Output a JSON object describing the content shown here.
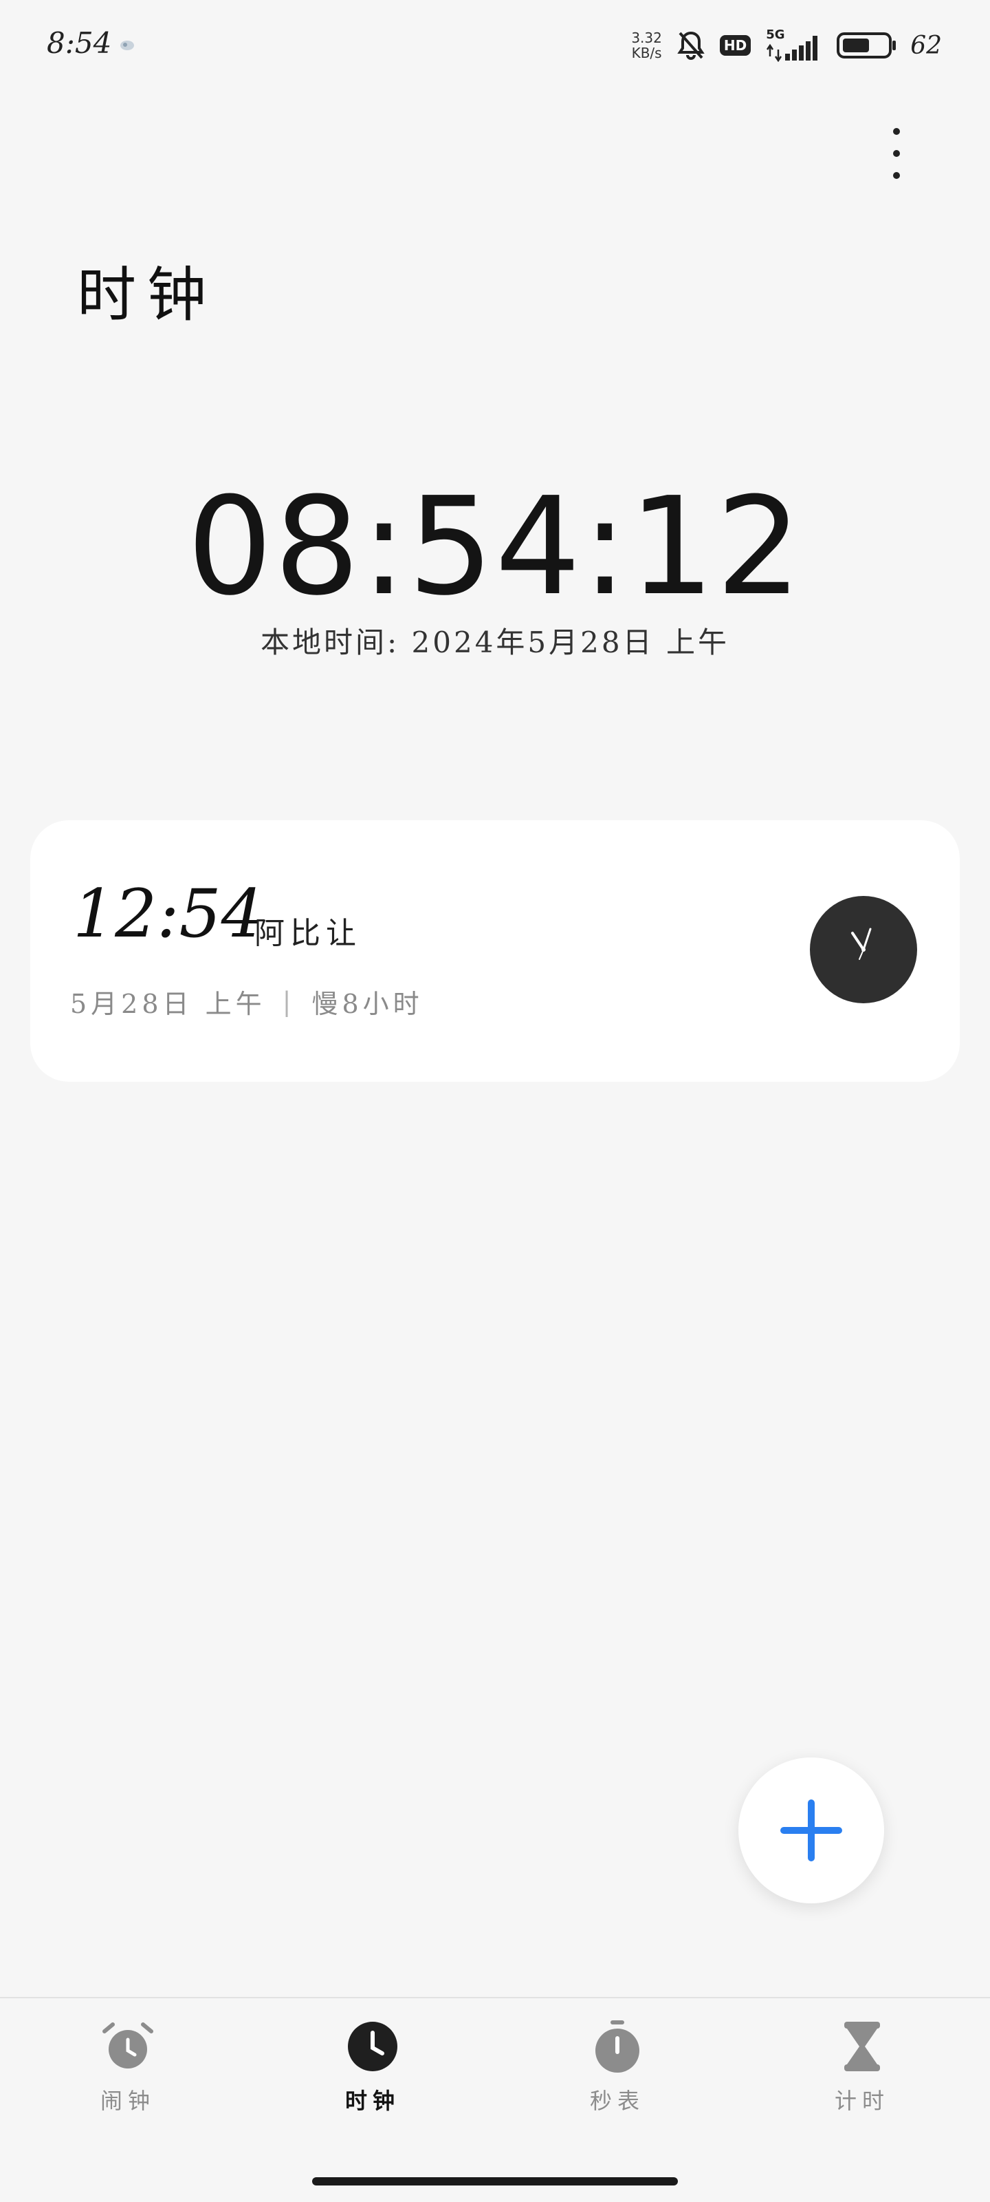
{
  "status_bar": {
    "time": "8:54",
    "net_speed_value": "3.32",
    "net_speed_unit": "KB/s",
    "hd_label": "HD",
    "network_label": "5G",
    "battery_percent": "62",
    "battery_level": 0.62,
    "icons": [
      "app-notification-icon",
      "bell-muted-icon",
      "hd-icon",
      "signal-5g-icon",
      "battery-icon"
    ]
  },
  "header": {
    "title": "时钟",
    "more_icon": "more-vertical-icon"
  },
  "main_clock": {
    "time": "08:54:12",
    "date_line": "本地时间: 2024年5月28日 上午"
  },
  "world_clocks": [
    {
      "time": "12:54",
      "city": "阿比让",
      "date": "5月28日 上午",
      "separator": "|",
      "offset": "慢8小时",
      "analog_icon": "analog-clock-icon"
    }
  ],
  "fab": {
    "icon": "plus-icon",
    "color": "#2a7ff0"
  },
  "bottom_nav": {
    "items": [
      {
        "label": "闹钟",
        "icon": "alarm-icon",
        "active": false
      },
      {
        "label": "时钟",
        "icon": "clock-icon",
        "active": true
      },
      {
        "label": "秒表",
        "icon": "stopwatch-icon",
        "active": false
      },
      {
        "label": "计时",
        "icon": "hourglass-icon",
        "active": false
      }
    ]
  },
  "colors": {
    "background": "#f6f6f6",
    "card": "#ffffff",
    "accent": "#2a7ff0",
    "inactive": "#8c8c8c",
    "active": "#141414"
  }
}
